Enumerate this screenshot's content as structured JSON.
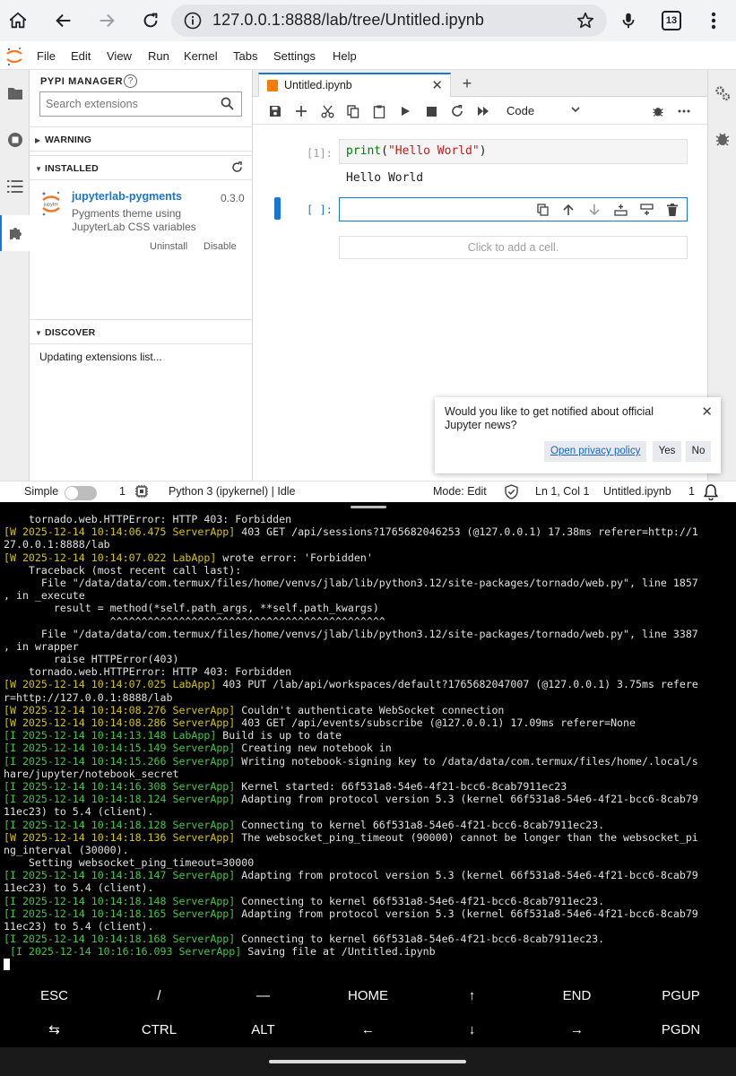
{
  "browser": {
    "url": "127.0.0.1:8888/lab/tree/Untitled.ipynb",
    "tab_count": "13"
  },
  "menubar": {
    "items": [
      "File",
      "Edit",
      "View",
      "Run",
      "Kernel",
      "Tabs",
      "Settings",
      "Help"
    ]
  },
  "extension_manager": {
    "title": "PYPI MANAGER",
    "help": "?",
    "search_placeholder": "Search extensions",
    "warning_label": "WARNING",
    "installed_label": "INSTALLED",
    "discover_label": "DISCOVER",
    "updating_text": "Updating extensions list...",
    "installed": [
      {
        "name": "jupyterlab-pygments",
        "version": "0.3.0",
        "description": "Pygments theme using JupyterLab CSS variables",
        "uninstall_label": "Uninstall",
        "disable_label": "Disable",
        "logo_text": "jupyter"
      }
    ]
  },
  "notebook": {
    "tab_title": "Untitled.ipynb",
    "cell_type": "Code",
    "cells": [
      {
        "prompt": "[1]:",
        "code_fn": "print",
        "code_open": "(",
        "code_str": "\"Hello World\"",
        "code_close": ")",
        "output": "Hello World"
      },
      {
        "prompt": "[ ]:"
      }
    ],
    "add_cell_text": "Click to add a cell."
  },
  "toast": {
    "message": "Would you like to get notified about official Jupyter news?",
    "privacy_label": "Open privacy policy",
    "yes_label": "Yes",
    "no_label": "No"
  },
  "statusbar": {
    "mode_simple": "Simple",
    "terminals": "1",
    "kernel": "Python 3 (ipykernel) | Idle",
    "mode": "Mode: Edit",
    "position": "Ln 1, Col 1",
    "filename": "Untitled.ipynb",
    "notifications": "1"
  },
  "terminal": {
    "lines": [
      {
        "pre": "",
        "tag": "",
        "text": "    tornado.web.HTTPError: HTTP 403: Forbidden"
      },
      {
        "pre": "",
        "tag": "[W 2025-12-14 10:14:06.475 ServerApp]",
        "level": "w",
        "text": " 403 GET /api/sessions?1765682046253 (@127.0.0.1) 17.38ms referer=http://1"
      },
      {
        "pre": "",
        "tag": "",
        "text": "27.0.0.1:8888/lab"
      },
      {
        "pre": "",
        "tag": "[W 2025-12-14 10:14:07.022 LabApp]",
        "level": "w",
        "text": " wrote error: 'Forbidden'"
      },
      {
        "pre": "",
        "tag": "",
        "text": "    Traceback (most recent call last):"
      },
      {
        "pre": "",
        "tag": "",
        "text": "      File \"/data/data/com.termux/files/home/venvs/jlab/lib/python3.12/site-packages/tornado/web.py\", line 1857"
      },
      {
        "pre": "",
        "tag": "",
        "text": ", in _execute"
      },
      {
        "pre": "",
        "tag": "",
        "text": "        result = method(*self.path_args, **self.path_kwargs)"
      },
      {
        "pre": "",
        "tag": "",
        "text": "                 ^^^^^^^^^^^^^^^^^^^^^^^^^^^^^^^^^^^^^^^^^^^^"
      },
      {
        "pre": "",
        "tag": "",
        "text": "      File \"/data/data/com.termux/files/home/venvs/jlab/lib/python3.12/site-packages/tornado/web.py\", line 3387"
      },
      {
        "pre": "",
        "tag": "",
        "text": ", in wrapper"
      },
      {
        "pre": "",
        "tag": "",
        "text": "        raise HTTPError(403)"
      },
      {
        "pre": "",
        "tag": "",
        "text": "    tornado.web.HTTPError: HTTP 403: Forbidden"
      },
      {
        "pre": "",
        "tag": "[W 2025-12-14 10:14:07.025 LabApp]",
        "level": "w",
        "text": " 403 PUT /lab/api/workspaces/default?1765682047007 (@127.0.0.1) 3.75ms refere"
      },
      {
        "pre": "",
        "tag": "",
        "text": "r=http://127.0.0.1:8888/lab"
      },
      {
        "pre": "",
        "tag": "[W 2025-12-14 10:14:08.276 ServerApp]",
        "level": "w",
        "text": " Couldn't authenticate WebSocket connection"
      },
      {
        "pre": "",
        "tag": "[W 2025-12-14 10:14:08.286 ServerApp]",
        "level": "w",
        "text": " 403 GET /api/events/subscribe (@127.0.0.1) 17.09ms referer=None"
      },
      {
        "pre": "",
        "tag": "[I 2025-12-14 10:14:13.148 LabApp]",
        "level": "i",
        "text": " Build is up to date"
      },
      {
        "pre": "",
        "tag": "[I 2025-12-14 10:14:15.149 ServerApp]",
        "level": "i",
        "text": " Creating new notebook in"
      },
      {
        "pre": "",
        "tag": "[I 2025-12-14 10:14:15.266 ServerApp]",
        "level": "i",
        "text": " Writing notebook-signing key to /data/data/com.termux/files/home/.local/s"
      },
      {
        "pre": "",
        "tag": "",
        "text": "hare/jupyter/notebook_secret"
      },
      {
        "pre": "",
        "tag": "[I 2025-12-14 10:14:16.308 ServerApp]",
        "level": "i",
        "text": " Kernel started: 66f531a8-54e6-4f21-bcc6-8cab7911ec23"
      },
      {
        "pre": "",
        "tag": "[I 2025-12-14 10:14:18.124 ServerApp]",
        "level": "i",
        "text": " Adapting from protocol version 5.3 (kernel 66f531a8-54e6-4f21-bcc6-8cab79"
      },
      {
        "pre": "",
        "tag": "",
        "text": "11ec23) to 5.4 (client)."
      },
      {
        "pre": "",
        "tag": "[I 2025-12-14 10:14:18.128 ServerApp]",
        "level": "i",
        "text": " Connecting to kernel 66f531a8-54e6-4f21-bcc6-8cab7911ec23."
      },
      {
        "pre": "",
        "tag": "[W 2025-12-14 10:14:18.136 ServerApp]",
        "level": "w",
        "text": " The websocket_ping_timeout (90000) cannot be longer than the websocket_pi"
      },
      {
        "pre": "",
        "tag": "",
        "text": "ng_interval (30000)."
      },
      {
        "pre": "",
        "tag": "",
        "text": "    Setting websocket_ping_timeout=30000"
      },
      {
        "pre": "",
        "tag": "[I 2025-12-14 10:14:18.147 ServerApp]",
        "level": "i",
        "text": " Adapting from protocol version 5.3 (kernel 66f531a8-54e6-4f21-bcc6-8cab79"
      },
      {
        "pre": "",
        "tag": "",
        "text": "11ec23) to 5.4 (client)."
      },
      {
        "pre": "",
        "tag": "[I 2025-12-14 10:14:18.148 ServerApp]",
        "level": "i",
        "text": " Connecting to kernel 66f531a8-54e6-4f21-bcc6-8cab7911ec23."
      },
      {
        "pre": "",
        "tag": "[I 2025-12-14 10:14:18.165 ServerApp]",
        "level": "i",
        "text": " Adapting from protocol version 5.3 (kernel 66f531a8-54e6-4f21-bcc6-8cab79"
      },
      {
        "pre": "",
        "tag": "",
        "text": "11ec23) to 5.4 (client)."
      },
      {
        "pre": "",
        "tag": "[I 2025-12-14 10:14:18.168 ServerApp]",
        "level": "i",
        "text": " Connecting to kernel 66f531a8-54e6-4f21-bcc6-8cab7911ec23."
      },
      {
        "pre": " ",
        "tag": "[I 2025-12-14 10:16:16.093 ServerApp]",
        "level": "i",
        "text": " Saving file at /Untitled.ipynb"
      }
    ]
  },
  "extra_keys": {
    "row1": [
      "ESC",
      "/",
      "—",
      "HOME",
      "↑",
      "END",
      "PGUP"
    ],
    "row2": [
      "⇆",
      "CTRL",
      "ALT",
      "←",
      "↓",
      "→",
      "PGDN"
    ]
  }
}
